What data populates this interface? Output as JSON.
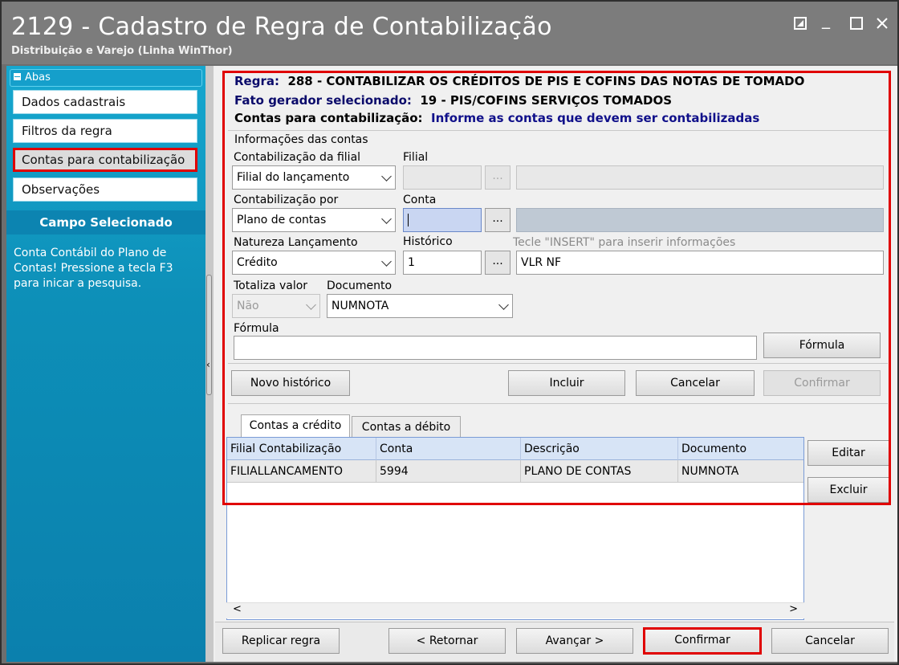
{
  "window": {
    "title": "2129 - Cadastro de Regra de Contabilização",
    "subtitle": "Distribuição e Varejo (Linha WinThor)",
    "controls": [
      "restore-icon",
      "minimize-icon",
      "maximize-icon",
      "close-icon"
    ]
  },
  "sidebar": {
    "section_label": "Abas",
    "items": [
      {
        "label": "Dados cadastrais"
      },
      {
        "label": "Filtros da regra"
      },
      {
        "label": "Contas para contabilização",
        "selected": true
      },
      {
        "label": "Observações"
      }
    ],
    "campo_title": "Campo Selecionado",
    "campo_text": "Conta Contábil do Plano de Contas! Pressione a tecla F3 para inicar a pesquisa."
  },
  "header": {
    "regra_label": "Regra:",
    "regra_value": "288 - CONTABILIZAR OS CRÉDITOS DE PIS E COFINS DAS NOTAS DE TOMADO",
    "fato_label": "Fato gerador selecionado:",
    "fato_value": "19 - PIS/COFINS SERVIÇOS TOMADOS",
    "contas_label": "Contas para contabilização:",
    "contas_value": "Informe as contas que devem ser contabilizadas"
  },
  "form": {
    "group_label": "Informações das contas",
    "contab_filial_label": "Contabilização da filial",
    "contab_filial_value": "Filial do lançamento",
    "filial_label": "Filial",
    "filial_code": "",
    "filial_desc": "",
    "contab_por_label": "Contabilização por",
    "contab_por_value": "Plano de contas",
    "conta_label": "Conta",
    "conta_code": "",
    "conta_desc": "",
    "natureza_label": "Natureza Lançamento",
    "natureza_value": "Crédito",
    "historico_label": "Histórico",
    "historico_hint": "Tecle  \"INSERT\" para inserir informações",
    "historico_code": "1",
    "historico_text": "VLR NF",
    "totaliza_label": "Totaliza valor",
    "totaliza_value": "Não",
    "documento_label": "Documento",
    "documento_value": "NUMNOTA",
    "formula_label": "Fórmula",
    "formula_value": "",
    "formula_button": "Fórmula",
    "dots": "..."
  },
  "actions": {
    "novo_historico": "Novo histórico",
    "incluir": "Incluir",
    "cancelar": "Cancelar",
    "confirmar": "Confirmar"
  },
  "tabs": [
    "Contas a crédito",
    "Contas a débito"
  ],
  "grid": {
    "columns": [
      "Filial Contabilização",
      "Conta",
      "Descrição",
      "Documento"
    ],
    "rows": [
      [
        "FILIALLANCAMENTO",
        "5994",
        "PLANO DE CONTAS",
        "NUMNOTA"
      ]
    ],
    "side_buttons": {
      "editar": "Editar",
      "excluir": "Excluir"
    },
    "scroll_left": "<",
    "scroll_right": ">"
  },
  "footer": {
    "replicar": "Replicar regra",
    "retornar": "< Retornar",
    "avancar": "Avançar >",
    "confirmar": "Confirmar",
    "cancelar": "Cancelar"
  },
  "colors": {
    "sidebar": "#0d8fb8",
    "highlight_red": "#e00000",
    "title_bar": "#7c7c7c"
  }
}
